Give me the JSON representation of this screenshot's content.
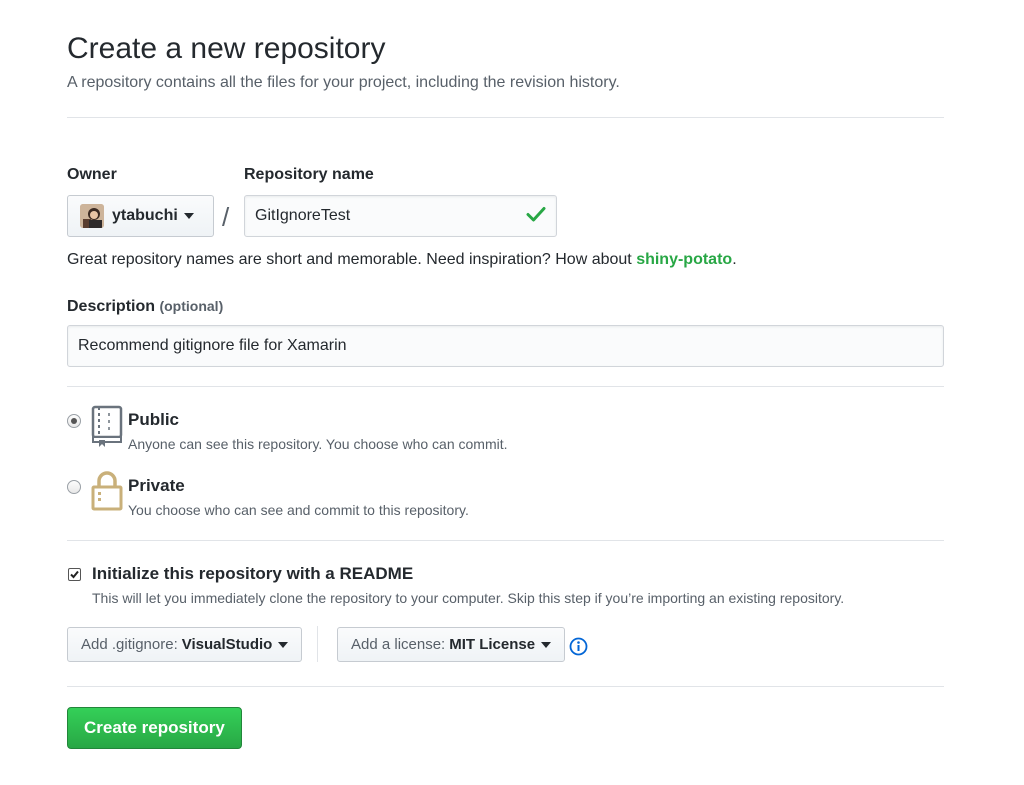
{
  "page": {
    "title": "Create a new repository",
    "subtitle": "A repository contains all the files for your project, including the revision history."
  },
  "owner": {
    "label": "Owner",
    "value": "ytabuchi"
  },
  "separator": "/",
  "repo_name": {
    "label": "Repository name",
    "value": "GitIgnoreTest"
  },
  "hint": {
    "text": "Great repository names are short and memorable. Need inspiration? How about ",
    "suggestion": "shiny-potato",
    "end": "."
  },
  "description": {
    "label": "Description",
    "optional": "(optional)",
    "value": "Recommend gitignore file for Xamarin"
  },
  "visibility": {
    "selected": "public",
    "public": {
      "title": "Public",
      "desc": "Anyone can see this repository. You choose who can commit."
    },
    "private": {
      "title": "Private",
      "desc": "You choose who can see and commit to this repository."
    }
  },
  "readme": {
    "checked": true,
    "label": "Initialize this repository with a README",
    "desc": "This will let you immediately clone the repository to your computer. Skip this step if you’re importing an existing repository."
  },
  "gitignore": {
    "prefix": "Add .gitignore:",
    "value": "VisualStudio"
  },
  "license": {
    "prefix": "Add a license:",
    "value": "MIT License"
  },
  "submit": {
    "label": "Create repository"
  },
  "colors": {
    "accent_green": "#28a745",
    "link_blue": "#0366d6",
    "check_green": "#28a745"
  }
}
